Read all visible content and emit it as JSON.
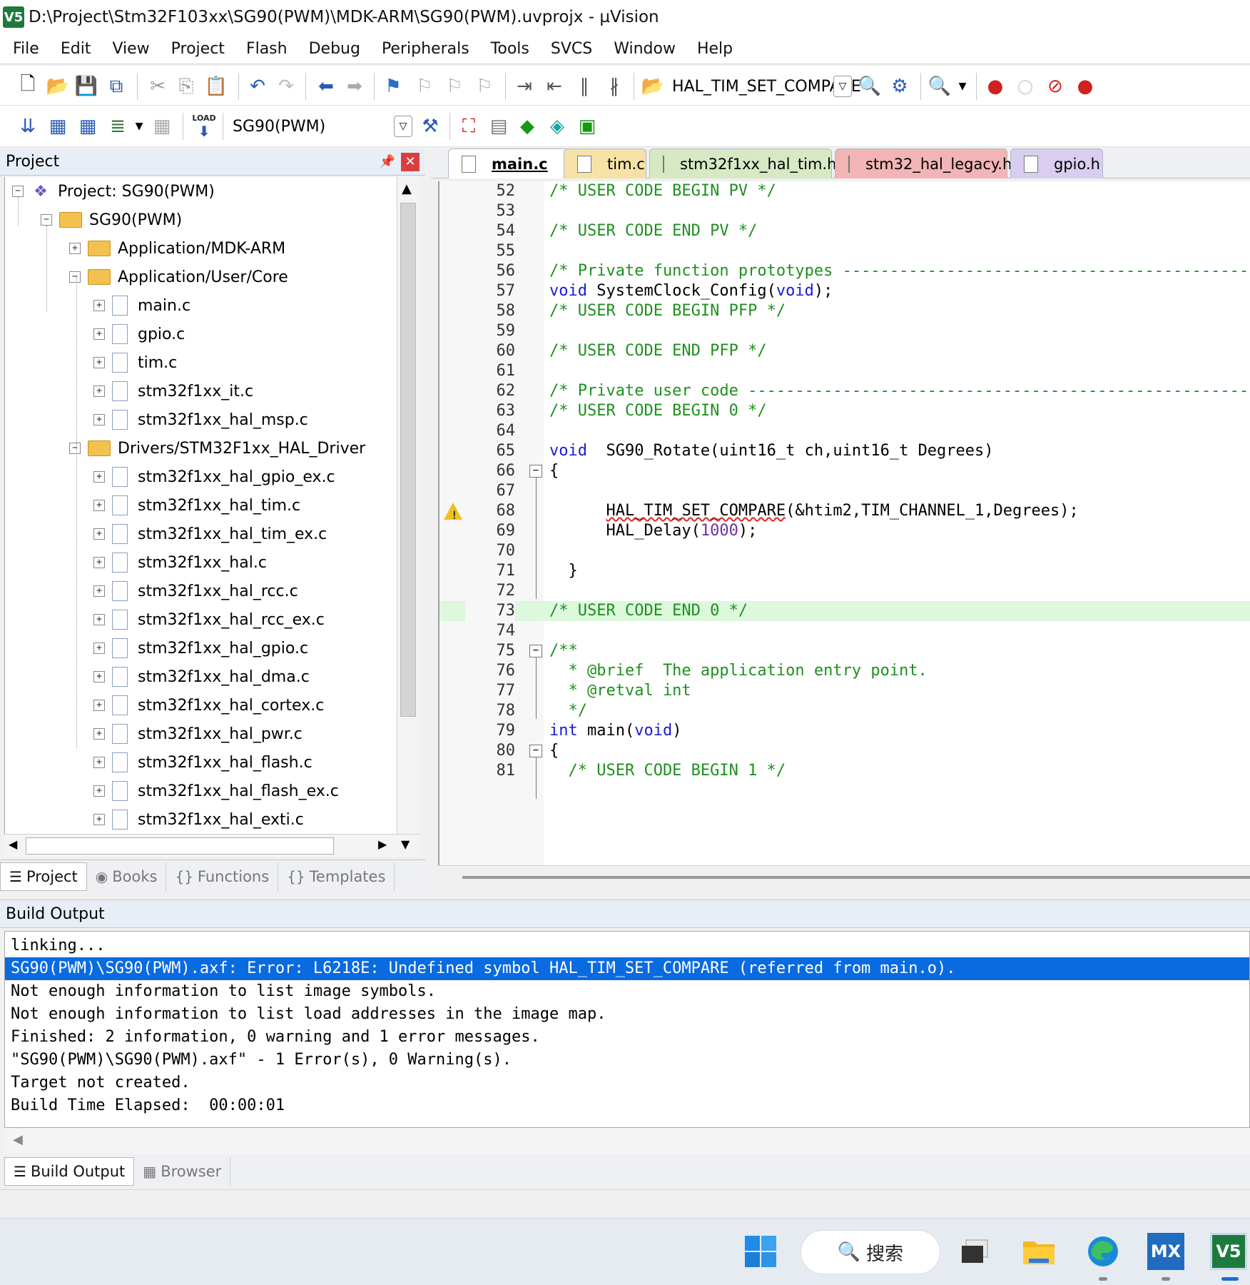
{
  "window": {
    "title": "D:\\Project\\Stm32F103xx\\SG90(PWM)\\MDK-ARM\\SG90(PWM).uvprojx - µVision",
    "app_icon": "V5"
  },
  "menu": [
    "File",
    "Edit",
    "View",
    "Project",
    "Flash",
    "Debug",
    "Peripherals",
    "Tools",
    "SVCS",
    "Window",
    "Help"
  ],
  "toolbar": {
    "find_combo": "HAL_TIM_SET_COMPARE",
    "target_combo": "SG90(PWM)",
    "load_label": "LOAD"
  },
  "project_panel": {
    "title": "Project",
    "pin_glyph": "■",
    "close_glyph": "✕",
    "tree": [
      {
        "label": "Project: SG90(PWM)",
        "depth": 0,
        "kind": "project",
        "toggle": "−"
      },
      {
        "label": "SG90(PWM)",
        "depth": 1,
        "kind": "folder",
        "toggle": "−"
      },
      {
        "label": "Application/MDK-ARM",
        "depth": 2,
        "kind": "folder",
        "toggle": "+"
      },
      {
        "label": "Application/User/Core",
        "depth": 2,
        "kind": "folder",
        "toggle": "−"
      },
      {
        "label": "main.c",
        "depth": 3,
        "kind": "file",
        "toggle": "+"
      },
      {
        "label": "gpio.c",
        "depth": 3,
        "kind": "file",
        "toggle": "+"
      },
      {
        "label": "tim.c",
        "depth": 3,
        "kind": "file",
        "toggle": "+"
      },
      {
        "label": "stm32f1xx_it.c",
        "depth": 3,
        "kind": "file",
        "toggle": "+"
      },
      {
        "label": "stm32f1xx_hal_msp.c",
        "depth": 3,
        "kind": "file",
        "toggle": "+"
      },
      {
        "label": "Drivers/STM32F1xx_HAL_Driver",
        "depth": 2,
        "kind": "folder",
        "toggle": "−"
      },
      {
        "label": "stm32f1xx_hal_gpio_ex.c",
        "depth": 3,
        "kind": "file",
        "toggle": "+"
      },
      {
        "label": "stm32f1xx_hal_tim.c",
        "depth": 3,
        "kind": "file",
        "toggle": "+"
      },
      {
        "label": "stm32f1xx_hal_tim_ex.c",
        "depth": 3,
        "kind": "file",
        "toggle": "+"
      },
      {
        "label": "stm32f1xx_hal.c",
        "depth": 3,
        "kind": "file",
        "toggle": "+"
      },
      {
        "label": "stm32f1xx_hal_rcc.c",
        "depth": 3,
        "kind": "file",
        "toggle": "+"
      },
      {
        "label": "stm32f1xx_hal_rcc_ex.c",
        "depth": 3,
        "kind": "file",
        "toggle": "+"
      },
      {
        "label": "stm32f1xx_hal_gpio.c",
        "depth": 3,
        "kind": "file",
        "toggle": "+"
      },
      {
        "label": "stm32f1xx_hal_dma.c",
        "depth": 3,
        "kind": "file",
        "toggle": "+"
      },
      {
        "label": "stm32f1xx_hal_cortex.c",
        "depth": 3,
        "kind": "file",
        "toggle": "+"
      },
      {
        "label": "stm32f1xx_hal_pwr.c",
        "depth": 3,
        "kind": "file",
        "toggle": "+"
      },
      {
        "label": "stm32f1xx_hal_flash.c",
        "depth": 3,
        "kind": "file",
        "toggle": "+"
      },
      {
        "label": "stm32f1xx_hal_flash_ex.c",
        "depth": 3,
        "kind": "file",
        "toggle": "+"
      },
      {
        "label": "stm32f1xx_hal_exti.c",
        "depth": 3,
        "kind": "file",
        "toggle": "+"
      }
    ],
    "tabs": [
      {
        "label": "Project",
        "icon": "☰",
        "active": true
      },
      {
        "label": "Books",
        "icon": "◉",
        "active": false
      },
      {
        "label": "Functions",
        "icon": "{}",
        "active": false
      },
      {
        "label": "Templates",
        "icon": "{}",
        "active": false
      }
    ]
  },
  "editor": {
    "tabs": [
      {
        "label": "main.c",
        "color": "#d6e4f6",
        "active": true
      },
      {
        "label": "tim.c",
        "color": "#f6e2a6",
        "active": false
      },
      {
        "label": "stm32f1xx_hal_tim.h",
        "color": "#d7e8c4",
        "active": false
      },
      {
        "label": "stm32_hal_legacy.h",
        "color": "#f2b4b4",
        "active": false
      },
      {
        "label": "gpio.h",
        "color": "#d9cdf0",
        "active": false
      }
    ],
    "lines": [
      {
        "n": "52",
        "parts": [
          [
            "/* USER CODE BEGIN PV */",
            "com"
          ]
        ]
      },
      {
        "n": "53",
        "parts": []
      },
      {
        "n": "54",
        "parts": [
          [
            "/* USER CODE END PV */",
            "com"
          ]
        ]
      },
      {
        "n": "55",
        "parts": []
      },
      {
        "n": "56",
        "parts": [
          [
            "/* Private function prototypes -----------------------------------------------*/",
            "com"
          ]
        ]
      },
      {
        "n": "57",
        "parts": [
          [
            "void",
            "kw"
          ],
          [
            " SystemClock_Config(",
            ""
          ],
          [
            "void",
            "kw"
          ],
          [
            ");",
            ""
          ]
        ]
      },
      {
        "n": "58",
        "parts": [
          [
            "/* USER CODE BEGIN PFP */",
            "com"
          ]
        ]
      },
      {
        "n": "59",
        "parts": []
      },
      {
        "n": "60",
        "parts": [
          [
            "/* USER CODE END PFP */",
            "com"
          ]
        ]
      },
      {
        "n": "61",
        "parts": []
      },
      {
        "n": "62",
        "parts": [
          [
            "/* Private user code ---------------------------------------------------------*/",
            "com"
          ]
        ]
      },
      {
        "n": "63",
        "parts": [
          [
            "/* USER CODE BEGIN 0 */",
            "com"
          ]
        ]
      },
      {
        "n": "64",
        "parts": []
      },
      {
        "n": "65",
        "parts": [
          [
            "void",
            "kw"
          ],
          [
            "  SG90_Rotate(uint16_t ch,uint16_t Degrees)",
            ""
          ]
        ]
      },
      {
        "n": "66",
        "parts": [
          [
            "{",
            ""
          ]
        ],
        "fold": "−"
      },
      {
        "n": "67",
        "parts": []
      },
      {
        "n": "68",
        "parts": [
          [
            "      ",
            ""
          ],
          [
            "HAL_TIM_SET_COMPARE",
            "err"
          ],
          [
            "(&htim2,TIM_CHANNEL_1,Degrees);",
            ""
          ]
        ],
        "warn": true
      },
      {
        "n": "69",
        "parts": [
          [
            "      HAL_Delay(",
            ""
          ],
          [
            "1000",
            "num"
          ],
          [
            ");",
            ""
          ]
        ]
      },
      {
        "n": "70",
        "parts": []
      },
      {
        "n": "71",
        "parts": [
          [
            "  }",
            ""
          ]
        ]
      },
      {
        "n": "72",
        "parts": []
      },
      {
        "n": "73",
        "parts": [
          [
            "/* USER CODE END 0 */",
            "com"
          ]
        ],
        "highlight": true
      },
      {
        "n": "74",
        "parts": []
      },
      {
        "n": "75",
        "parts": [
          [
            "/**",
            "com"
          ]
        ],
        "fold": "−"
      },
      {
        "n": "76",
        "parts": [
          [
            "  * @brief  The application entry point.",
            "com"
          ]
        ]
      },
      {
        "n": "77",
        "parts": [
          [
            "  * @retval int",
            "com"
          ]
        ]
      },
      {
        "n": "78",
        "parts": [
          [
            "  */",
            "com"
          ]
        ]
      },
      {
        "n": "79",
        "parts": [
          [
            "int",
            "kw"
          ],
          [
            " main(",
            ""
          ],
          [
            "void",
            "kw"
          ],
          [
            ")",
            ""
          ]
        ]
      },
      {
        "n": "80",
        "parts": [
          [
            "{",
            ""
          ]
        ],
        "fold": "−"
      },
      {
        "n": "81",
        "parts": [
          [
            "  /* USER CODE BEGIN 1 */",
            "com"
          ]
        ]
      }
    ]
  },
  "build_output": {
    "title": "Build Output",
    "lines": [
      "linking...",
      "SG90(PWM)\\SG90(PWM).axf: Error: L6218E: Undefined symbol HAL_TIM_SET_COMPARE (referred from main.o).",
      "Not enough information to list image symbols.",
      "Not enough information to list load addresses in the image map.",
      "Finished: 2 information, 0 warning and 1 error messages.",
      "\"SG90(PWM)\\SG90(PWM).axf\" - 1 Error(s), 0 Warning(s).",
      "Target not created.",
      "Build Time Elapsed:  00:00:01"
    ],
    "selected_index": 1,
    "tabs": [
      {
        "label": "Build Output",
        "icon": "☰",
        "active": true
      },
      {
        "label": "Browser",
        "icon": "▦",
        "active": false
      }
    ]
  },
  "taskbar": {
    "search_label": "搜索",
    "mx_label": "MX",
    "keil_label": "V5"
  },
  "colors": {
    "accent_selection": "#0a6ae0",
    "comment": "#1f8f1f",
    "keyword": "#1a1ad6"
  }
}
